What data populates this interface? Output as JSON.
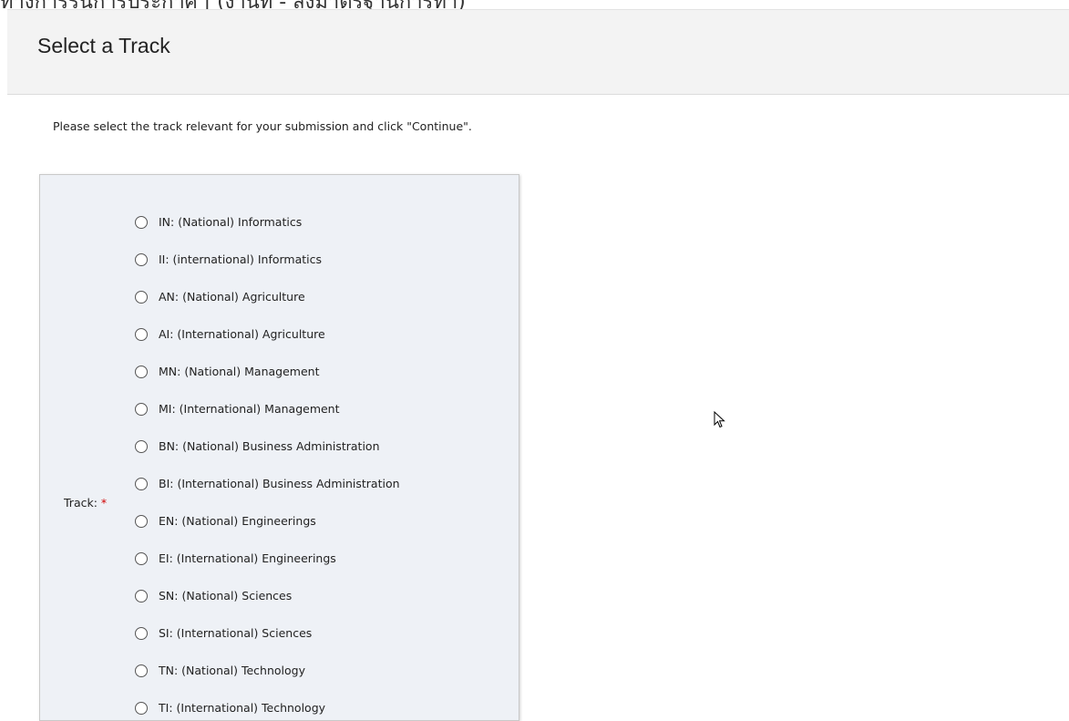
{
  "top_strip": {
    "text": "ทางการรุ่นการประกาศ | (งานที่ - ส่งมาตรฐานการทำ)"
  },
  "header": {
    "title": "Select a Track"
  },
  "instructions": "Please select the track relevant for your submission and click \"Continue\".",
  "form": {
    "track_label": "Track:",
    "required_marker": "*",
    "options": [
      {
        "label": "IN: (National) Informatics",
        "selected": false
      },
      {
        "label": "II: (international) Informatics",
        "selected": false
      },
      {
        "label": "AN: (National) Agriculture",
        "selected": false
      },
      {
        "label": "AI: (International) Agriculture",
        "selected": false
      },
      {
        "label": "MN: (National) Management",
        "selected": false
      },
      {
        "label": "MI: (International) Management",
        "selected": false
      },
      {
        "label": "BN: (National) Business Administration",
        "selected": false
      },
      {
        "label": "BI: (International) Business Administration",
        "selected": false
      },
      {
        "label": "EN: (National) Engineerings",
        "selected": false
      },
      {
        "label": "EI: (International) Engineerings",
        "selected": false
      },
      {
        "label": "SN: (National) Sciences",
        "selected": false
      },
      {
        "label": "SI: (International) Sciences",
        "selected": false
      },
      {
        "label": "TN: (National) Technology",
        "selected": false
      },
      {
        "label": "TI: (International) Technology",
        "selected": false
      }
    ]
  },
  "colors": {
    "header_bg": "#f3f3f3",
    "panel_bg": "#eef1f6",
    "required": "#d00000"
  }
}
